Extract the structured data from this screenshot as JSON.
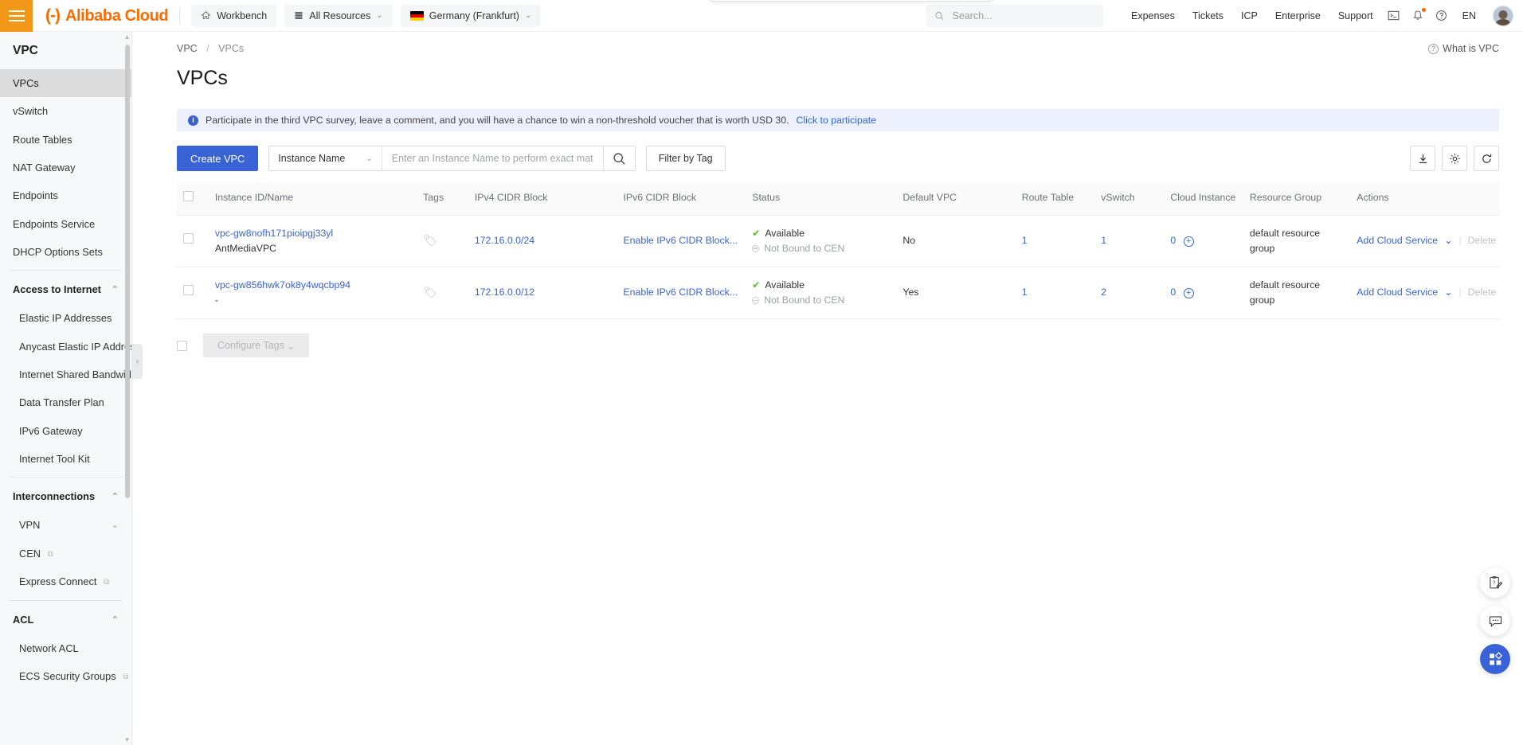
{
  "header": {
    "menu_icon": "hamburger-icon",
    "brand_mark": "(-)",
    "brand": "Alibaba Cloud",
    "workbench": "Workbench",
    "all_resources": "All Resources",
    "region": "Germany (Frankfurt)",
    "search_placeholder": "Search...",
    "search_value": "",
    "nav": [
      "Expenses",
      "Tickets",
      "ICP",
      "Enterprise",
      "Support"
    ],
    "lang": "EN",
    "icons": [
      "console-icon",
      "bell-icon",
      "help-icon"
    ]
  },
  "sidebar": {
    "title": "VPC",
    "items": [
      {
        "label": "VPCs",
        "active": true
      },
      {
        "label": "vSwitch",
        "active": false
      },
      {
        "label": "Route Tables",
        "active": false
      },
      {
        "label": "NAT Gateway",
        "active": false
      },
      {
        "label": "Endpoints",
        "active": false
      },
      {
        "label": "Endpoints Service",
        "active": false
      },
      {
        "label": "DHCP Options Sets",
        "active": false
      }
    ],
    "groups": [
      {
        "label": "Access to Internet",
        "items": [
          {
            "label": "Elastic IP Addresses",
            "external": false
          },
          {
            "label": "Anycast Elastic IP Addresses",
            "external": false
          },
          {
            "label": "Internet Shared Bandwidth",
            "external": false
          },
          {
            "label": "Data Transfer Plan",
            "external": false
          },
          {
            "label": "IPv6 Gateway",
            "external": false
          },
          {
            "label": "Internet Tool Kit",
            "external": false
          }
        ]
      },
      {
        "label": "Interconnections",
        "items": [
          {
            "label": "VPN",
            "external": false,
            "expandable": true
          },
          {
            "label": "CEN",
            "external": true
          },
          {
            "label": "Express Connect",
            "external": true
          }
        ]
      },
      {
        "label": "ACL",
        "items": [
          {
            "label": "Network ACL",
            "external": false
          },
          {
            "label": "ECS Security Groups",
            "external": true
          }
        ]
      }
    ]
  },
  "breadcrumb": {
    "root": "VPC",
    "sep": "/",
    "current": "VPCs"
  },
  "page": {
    "title": "VPCs",
    "what_is": "What is VPC"
  },
  "banner": {
    "text": "Participate in the third VPC survey, leave a comment, and you will have a chance to win a non-threshold voucher that is worth USD 30.",
    "link": "Click to participate"
  },
  "toolbar": {
    "create_label": "Create VPC",
    "filter_field": "Instance Name",
    "search_placeholder": "Enter an Instance Name to perform exact match",
    "search_value": "",
    "filter_by_tag": "Filter by Tag",
    "icons": [
      "download-icon",
      "gear-icon",
      "refresh-icon"
    ]
  },
  "table": {
    "columns": [
      "Instance ID/Name",
      "Tags",
      "IPv4 CIDR Block",
      "IPv6 CIDR Block",
      "Status",
      "Default VPC",
      "Route Table",
      "vSwitch",
      "Cloud Instance",
      "Resource Group",
      "Actions"
    ],
    "rows": [
      {
        "instance_id": "vpc-gw8nofh171pioipgj33yl",
        "instance_name": "AntMediaVPC",
        "ipv4": "172.16.0.0/24",
        "ipv6": "Enable IPv6 CIDR Block...",
        "status": "Available",
        "cen_status": "Not Bound to CEN",
        "default_vpc": "No",
        "route_table": "1",
        "vswitch": "1",
        "cloud_instance": "0",
        "resource_group": "default resource group",
        "action_primary": "Add Cloud Service",
        "action_secondary": "Delete"
      },
      {
        "instance_id": "vpc-gw856hwk7ok8y4wqcbp94",
        "instance_name": "-",
        "ipv4": "172.16.0.0/12",
        "ipv6": "Enable IPv6 CIDR Block...",
        "status": "Available",
        "cen_status": "Not Bound to CEN",
        "default_vpc": "Yes",
        "route_table": "1",
        "vswitch": "2",
        "cloud_instance": "0",
        "resource_group": "default resource group",
        "action_primary": "Add Cloud Service",
        "action_secondary": "Delete"
      }
    ]
  },
  "bulk": {
    "configure_tags": "Configure Tags"
  },
  "fabs": [
    "survey-icon",
    "feedback-icon",
    "apps-icon"
  ],
  "colors": {
    "brand_orange": "#ff6a00",
    "primary_blue": "#3a62d7",
    "success_green": "#52c41a",
    "banner_bg": "#edf1fd"
  }
}
